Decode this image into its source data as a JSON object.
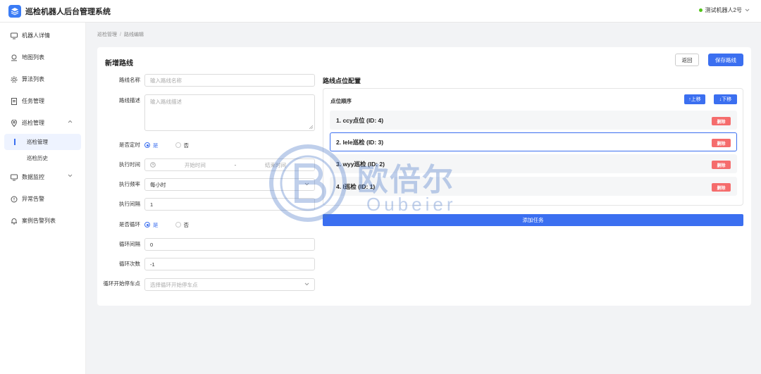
{
  "app": {
    "title": "巡检机器人后台管理系统"
  },
  "header": {
    "robot_selected": "测试机器人2号"
  },
  "sidebar": {
    "items": [
      {
        "label": "机器人详情",
        "icon": "monitor-icon"
      },
      {
        "label": "地图列表",
        "icon": "map-pin-icon"
      },
      {
        "label": "算法列表",
        "icon": "gear-icon"
      },
      {
        "label": "任务管理",
        "icon": "document-icon"
      },
      {
        "label": "巡检管理",
        "icon": "location-icon",
        "expanded": true
      },
      {
        "label": "数据监控",
        "icon": "monitor-icon"
      },
      {
        "label": "异常告警",
        "icon": "alert-circle-icon"
      },
      {
        "label": "案例告警列表",
        "icon": "bell-icon"
      }
    ],
    "sub_items": [
      {
        "label": "巡检管理",
        "active": true
      },
      {
        "label": "巡检历史",
        "active": false
      }
    ]
  },
  "breadcrumb": {
    "parent": "巡检管理",
    "separator": "/",
    "current": "路线编辑"
  },
  "page": {
    "title": "新增路线",
    "back_label": "返回",
    "save_label": "保存路线"
  },
  "form": {
    "route_name": {
      "label": "路线名称",
      "placeholder": "输入路线名称"
    },
    "route_desc": {
      "label": "路线描述",
      "placeholder": "输入路线描述"
    },
    "scheduled": {
      "label": "是否定时",
      "options": [
        "是",
        "否"
      ],
      "selected": "是"
    },
    "exec_time": {
      "label": "执行时间",
      "start_placeholder": "开始时间",
      "range_sep": "-",
      "end_placeholder": "结束时间"
    },
    "exec_freq": {
      "label": "执行频率",
      "value": "每小时"
    },
    "exec_interval": {
      "label": "执行间隔",
      "value": "1"
    },
    "loop": {
      "label": "是否循环",
      "options": [
        "是",
        "否"
      ],
      "selected": "是"
    },
    "loop_interval": {
      "label": "循环间隔",
      "value": "0"
    },
    "loop_count": {
      "label": "循环次数",
      "value": "-1"
    },
    "loop_start": {
      "label": "循环开始停车点",
      "placeholder": "选择循环开始停车点"
    }
  },
  "points_config": {
    "title": "路线点位配置",
    "order_label": "点位顺序",
    "move_up_label": "↑上移",
    "move_down_label": "↓下移",
    "delete_label": "删除",
    "points": [
      {
        "label": "1. ccy点位 (ID: 4)",
        "selected": false
      },
      {
        "label": "2. lele巡检 (ID: 3)",
        "selected": true
      },
      {
        "label": "3. wyy巡检 (ID: 2)",
        "selected": false
      },
      {
        "label": "4. l巡检 (ID: 1)",
        "selected": false
      }
    ],
    "add_task_label": "添加任务"
  },
  "watermark": {
    "cn": "欧倍尔",
    "en": "Oubeier"
  },
  "colors": {
    "primary": "#3b6ff0",
    "danger": "#f56c6c",
    "success": "#52c41a"
  }
}
